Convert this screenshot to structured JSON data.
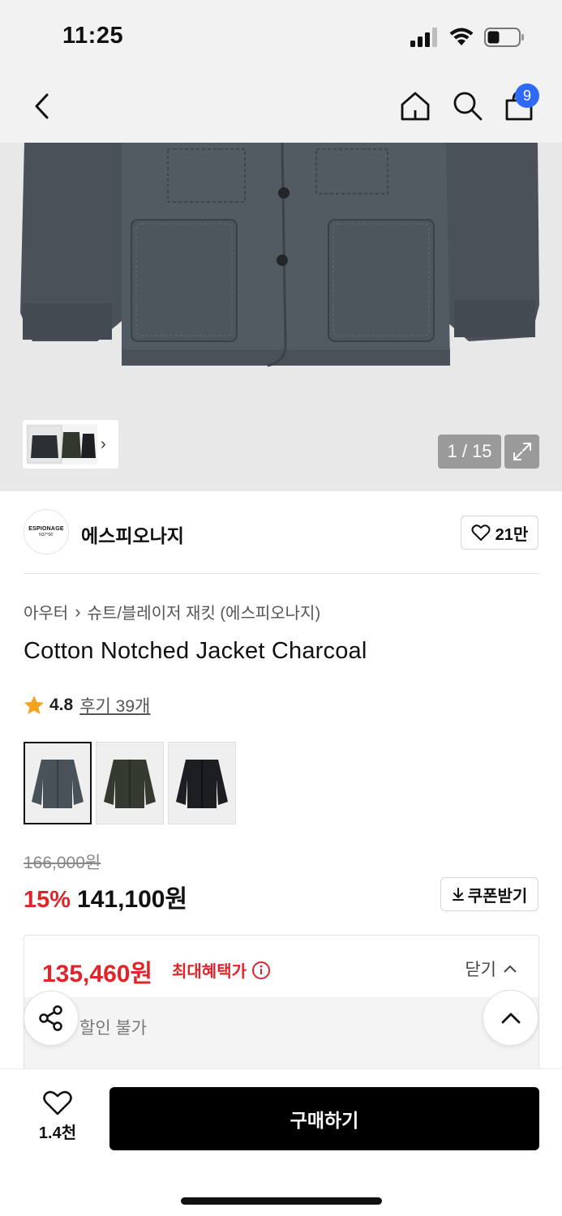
{
  "status_bar": {
    "time": "11:25"
  },
  "header": {
    "cart_count": "9"
  },
  "gallery": {
    "counter": "1 / 15"
  },
  "brand": {
    "logo_text": "ESPIONAGE",
    "logo_subtext": "N37°56'",
    "name": "에스피오나지",
    "like_count": "21만"
  },
  "breadcrumb": {
    "category": "아우터",
    "subcategory": "슈트/블레이저 재킷 (에스피오나지)"
  },
  "product": {
    "title": "Cotton Notched Jacket Charcoal",
    "rating": "4.8",
    "review_text": "후기 39개",
    "original_price": "166,000원",
    "discount": "15%",
    "sale_price": "141,100원",
    "coupon_label": "쿠폰받기",
    "color_options": [
      "charcoal",
      "olive",
      "black"
    ]
  },
  "benefit": {
    "price": "135,460원",
    "label": "최대혜택가",
    "close_label": "닫기",
    "note": "할인 불가"
  },
  "bottom_bar": {
    "wish_count": "1.4천",
    "buy_label": "구매하기"
  },
  "colors": {
    "accent_red": "#e0242a",
    "badge_blue": "#2f6af6"
  }
}
